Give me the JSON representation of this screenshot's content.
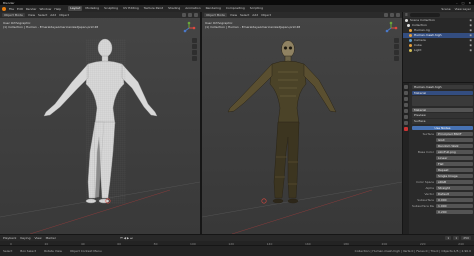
{
  "titlebar": {
    "title": "Blender"
  },
  "menu": {
    "items": [
      "File",
      "Edit",
      "Render",
      "Window",
      "Help"
    ],
    "workspaces": [
      "Layout",
      "Modeling",
      "Sculpting",
      "UV Editing",
      "Texture Paint",
      "Shading",
      "Animation",
      "Rendering",
      "Compositing",
      "Scripting"
    ],
    "scene": "Scene",
    "view_layer": "View Layer"
  },
  "viewport_left": {
    "mode": "Object Mode",
    "view_menu": [
      "View",
      "Select",
      "Add",
      "Object"
    ],
    "overlay_line1": "User Orthographic",
    "overlay_line2": "(1) Collection | Human - EmeraldeyeAmericanizedJapan.prim48"
  },
  "viewport_right": {
    "mode": "Object Mode",
    "view_menu": [
      "View",
      "Select",
      "Add",
      "Object"
    ],
    "overlay_line1": "User Orthographic",
    "overlay_line2": "(1) Collection | Human - EmeraldeyeAmericanizedJapan.prim48"
  },
  "outliner": {
    "title": "Scene Collection",
    "rows": [
      {
        "label": "Scene Collection",
        "color": "#dddddd",
        "selected": false
      },
      {
        "label": "Collection",
        "color": "#dddddd",
        "selected": false
      },
      {
        "label": "Human.rig",
        "color": "#e8a03a",
        "selected": false
      },
      {
        "label": "Human.mesh.high",
        "color": "#e8a03a",
        "selected": true
      },
      {
        "label": "Camera",
        "color": "#5fa0d0",
        "selected": false
      },
      {
        "label": "Cube",
        "color": "#e8a03a",
        "selected": false
      },
      {
        "label": "Light",
        "color": "#d4c058",
        "selected": false
      }
    ]
  },
  "properties": {
    "object_field": "Human.mesh.high",
    "material_slot": "Material",
    "material_name": "Material",
    "panels": {
      "preview": "Preview",
      "surface": "Surface"
    },
    "use_nodes_button": "Use Nodes",
    "rows": [
      {
        "label": "Surface",
        "value": "Principled BSDF"
      },
      {
        "label": "",
        "value": "GGX"
      },
      {
        "label": "",
        "value": "Random Walk"
      },
      {
        "label": "Base Color",
        "value": "skinFull.png"
      },
      {
        "label": "",
        "value": "Linear"
      },
      {
        "label": "",
        "value": "Flat"
      },
      {
        "label": "",
        "value": "Repeat"
      },
      {
        "label": "",
        "value": "Single Image"
      },
      {
        "label": "Color Space",
        "value": "sRGB"
      },
      {
        "label": "Alpha",
        "value": "Straight"
      },
      {
        "label": "Vector",
        "value": "Default"
      },
      {
        "label": "Subsurface",
        "value": "0.000"
      },
      {
        "label": "Subsurface Radius",
        "value": "1.000"
      },
      {
        "label": "",
        "value": "0.200"
      }
    ]
  },
  "timeline": {
    "menu": [
      "Playback",
      "Keying",
      "View",
      "Marker"
    ],
    "frame_current": "1",
    "frame_start": "1",
    "frame_end": "250",
    "ticks": [
      "0",
      "20",
      "40",
      "60",
      "80",
      "100",
      "120",
      "140",
      "160",
      "180",
      "200",
      "220",
      "240"
    ]
  },
  "statusbar": {
    "hints": [
      "Select",
      "Box Select",
      "Rotate View",
      "Object Context Menu"
    ],
    "version": "Collection | Human.mesh.high | Verts:0 | Faces:0 | Tris:0 | Objects:1/5 | 2.90.0"
  }
}
